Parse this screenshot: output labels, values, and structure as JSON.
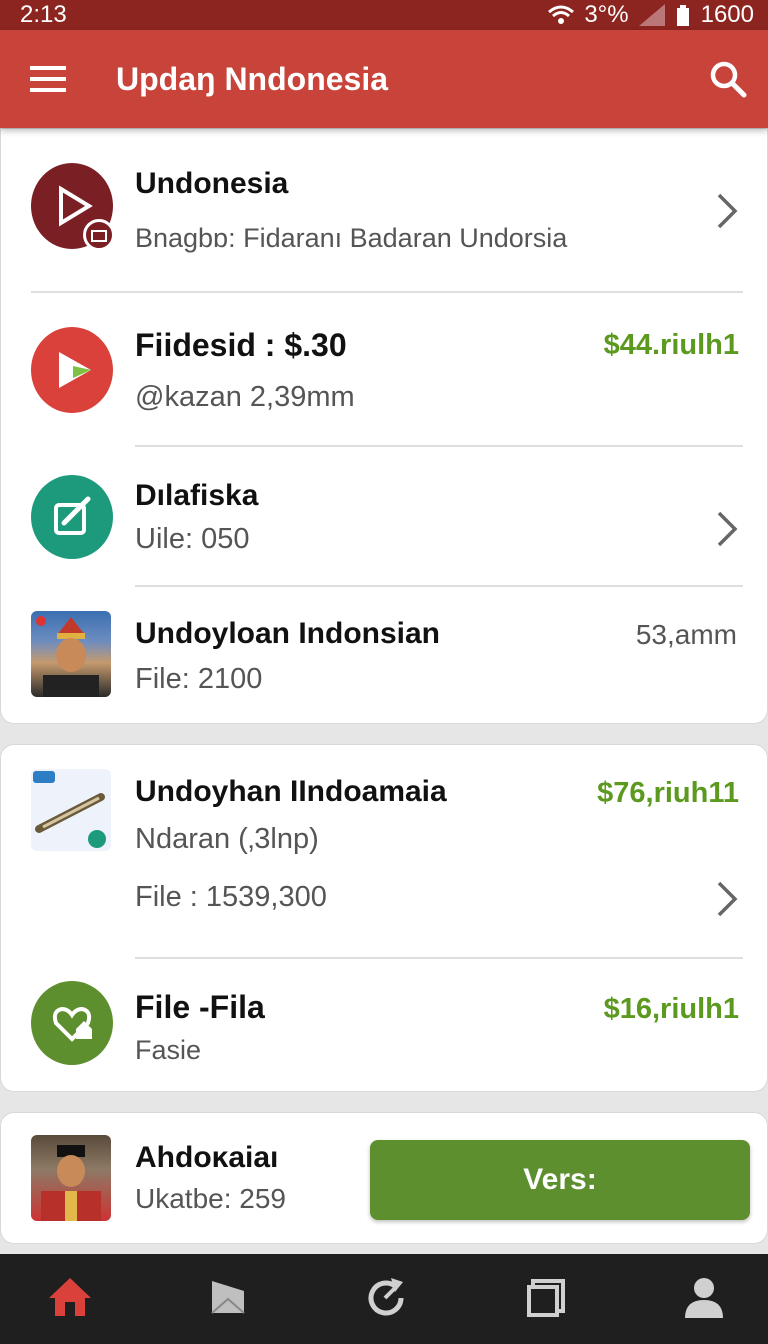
{
  "status_bar": {
    "time": "2:13",
    "signal_text": "3°%",
    "battery_text": "1600"
  },
  "app_bar": {
    "title": "Updaŋ Nndonesia",
    "menu_icon": "menu-icon",
    "search_icon": "search-icon"
  },
  "list": [
    {
      "title": "Undonesia",
      "subtitle": "Bnagbɒ: Fidaranı Badaran Undorsia",
      "icon": "play-icon",
      "icon_color": "#7a1f24"
    },
    {
      "title": "Fiidesid :  $.30",
      "subtitle": "@kazan 2,39mm",
      "right_value": "$44.riulh1",
      "icon": "play-icon",
      "icon_color": "#d9413a"
    },
    {
      "title": "Dılafiska",
      "subtitle": "Uile: 050",
      "icon": "edit-icon",
      "icon_color": "#1d9a7c"
    },
    {
      "title": "Undoyloan Indonsian",
      "subtitle": "File: 2100",
      "right_text": "53,amm"
    }
  ],
  "list2": [
    {
      "title": "Undoyhan IIndoamaia",
      "subtitle": "Ndaran (‚3lnp)",
      "line3": "File : 1539,300",
      "right_value": "$76,riuh11"
    },
    {
      "title": "File -Fila",
      "subtitle": "Fasie",
      "right_value": "$16,riulh1",
      "icon": "heart-home-icon",
      "icon_color": "#5e8f2f"
    }
  ],
  "bottom_card": {
    "title": "Ahdoĸaiaı",
    "subtitle": "Ukatbe: 259",
    "button_label": "Vers:"
  },
  "bottom_nav": [
    "home-icon",
    "mail-icon",
    "refresh-icon",
    "window-icon",
    "profile-icon"
  ],
  "colors": {
    "accent_red": "#c8433a",
    "dark_red": "#8c2420",
    "green": "#5e8f2f",
    "price_green": "#5b9a1e"
  }
}
